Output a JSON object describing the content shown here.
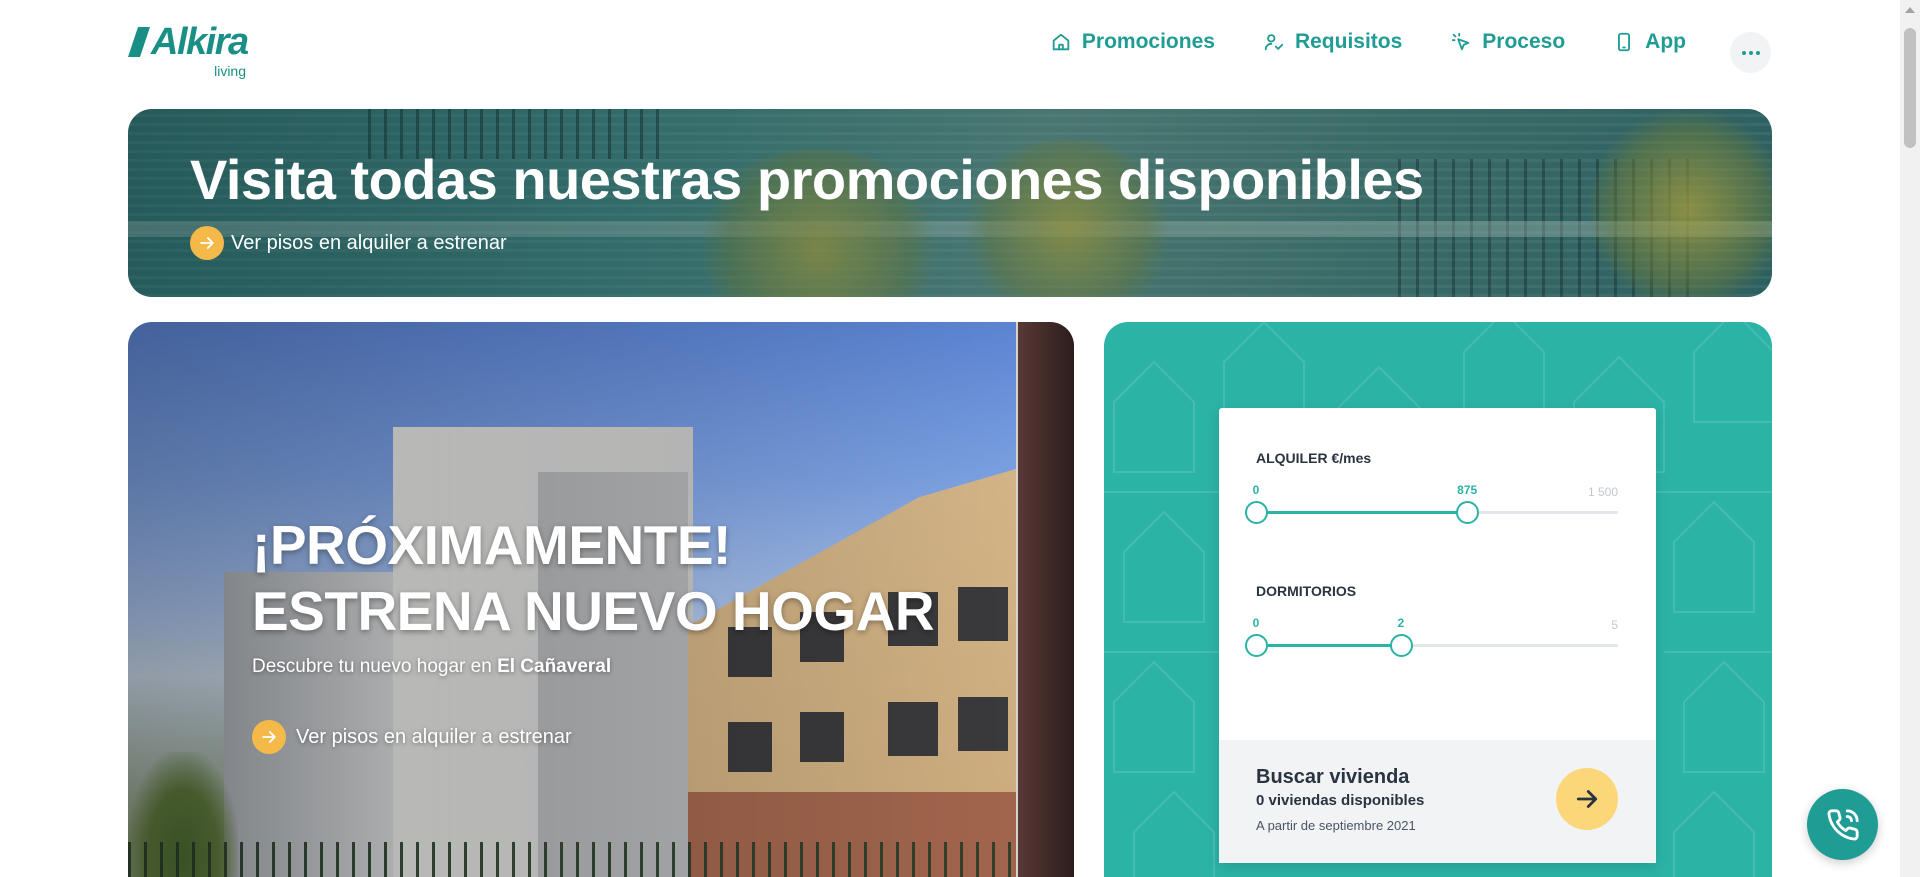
{
  "brand": {
    "name": "Alkira",
    "tagline": "living",
    "primary_color": "#1f9c93",
    "accent_color": "#f5b94a",
    "panel_color": "#2bb3a6"
  },
  "nav": {
    "items": [
      {
        "label": "Promociones",
        "icon": "home-icon"
      },
      {
        "label": "Requisitos",
        "icon": "user-check-icon"
      },
      {
        "label": "Proceso",
        "icon": "cursor-click-icon"
      },
      {
        "label": "App",
        "icon": "smartphone-icon"
      }
    ],
    "more_icon": "more-horizontal-icon"
  },
  "banner": {
    "title": "Visita todas nuestras promociones disponibles",
    "link_label": "Ver pisos en alquiler a estrenar"
  },
  "hero": {
    "title_line1": "¡PRÓXIMAMENTE!",
    "title_line2": "ESTRENA NUEVO HOGAR",
    "subtitle_prefix": "Descubre tu nuevo hogar en ",
    "subtitle_place": "El Cañaveral",
    "link_label": "Ver pisos en alquiler a estrenar"
  },
  "filters": {
    "rent": {
      "label": "ALQUILER €/mes",
      "min": 0,
      "max": 1500,
      "min_label": "0",
      "max_label": "1 500",
      "low": 0,
      "high": 875,
      "low_label": "0",
      "high_label": "875"
    },
    "bedrooms": {
      "label": "DORMITORIOS",
      "min": 0,
      "max": 5,
      "min_label": "0",
      "max_label": "5",
      "low": 0,
      "high": 2,
      "low_label": "0",
      "high_label": "2"
    }
  },
  "search": {
    "title": "Buscar vivienda",
    "count": "0 viviendas disponibles",
    "availability": "A partir de septiembre 2021"
  },
  "call_button": {
    "icon": "phone-call-icon"
  }
}
